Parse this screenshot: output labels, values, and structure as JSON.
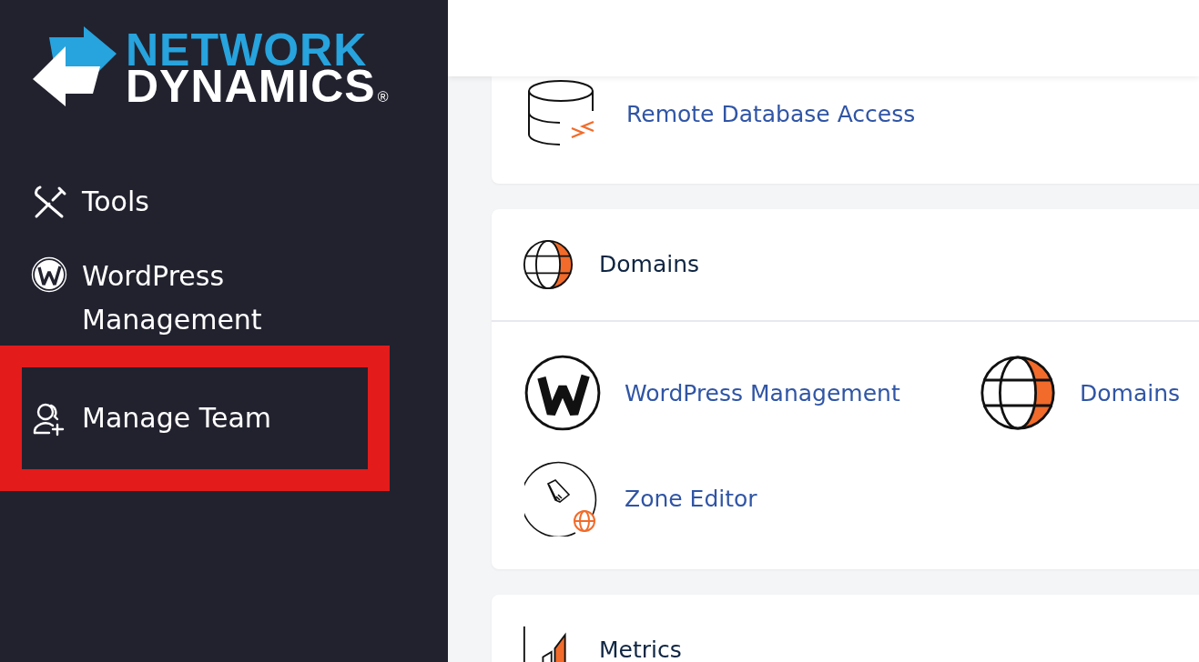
{
  "sidebar": {
    "logo": {
      "line_1": "NETWORK",
      "line_2": "DYNAMICS",
      "mark": "®"
    },
    "items": [
      {
        "label": "Tools",
        "highlighted": false
      },
      {
        "label": "WordPress Management",
        "highlighted": false
      },
      {
        "label": "Manage Team",
        "highlighted": true
      }
    ]
  },
  "sections": [
    {
      "kind": "links",
      "items": [
        {
          "label": "Remote Database Access"
        }
      ]
    },
    {
      "kind": "group",
      "title": "Domains",
      "items": [
        {
          "label": "WordPress Management"
        },
        {
          "label": "Domains"
        },
        {
          "label": "Zone Editor"
        }
      ]
    },
    {
      "kind": "group",
      "title": "Metrics"
    }
  ]
}
